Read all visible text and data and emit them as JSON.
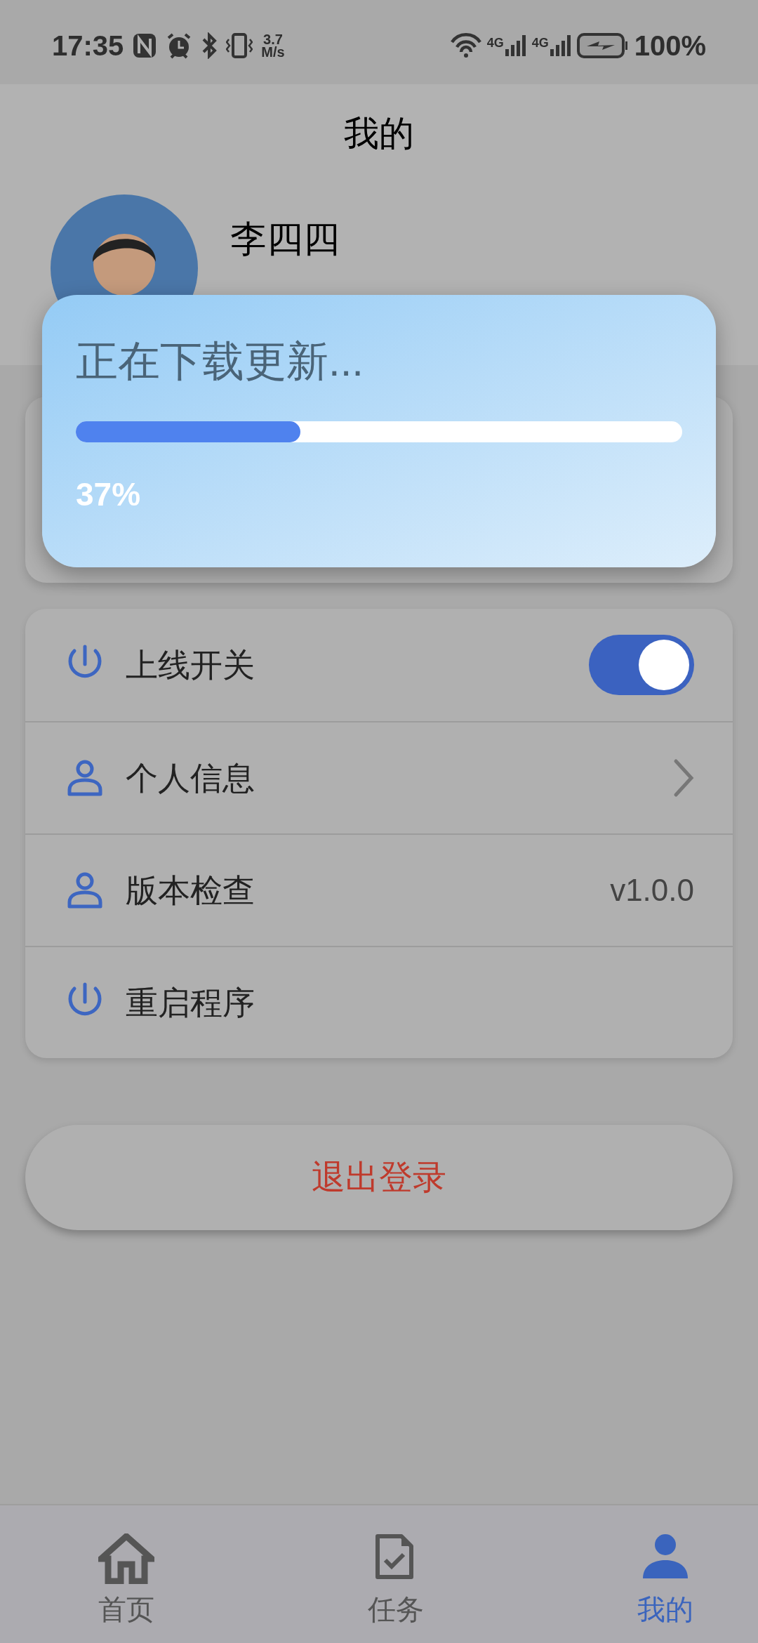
{
  "status_bar": {
    "time": "17:35",
    "speed_value": "3.7",
    "speed_unit": "M/s",
    "network_1": "4G",
    "network_2": "4G",
    "battery": "100%"
  },
  "header": {
    "title": "我的"
  },
  "profile": {
    "name": "李四四"
  },
  "dialog": {
    "title": "正在下载更新...",
    "level": 0.37,
    "percent": "37%"
  },
  "settings": [
    {
      "kind": "toggle",
      "label": "上线开关",
      "on": true
    },
    {
      "kind": "link",
      "label": "个人信息"
    },
    {
      "kind": "value",
      "label": "版本检查",
      "value": "v1.0.0"
    },
    {
      "kind": "plain",
      "label": "重启程序"
    }
  ],
  "logout": {
    "label": "退出登录"
  },
  "tabs": [
    {
      "label": "首页",
      "selected": false
    },
    {
      "label": "任务",
      "selected": false
    },
    {
      "label": "我的",
      "selected": true
    }
  ]
}
